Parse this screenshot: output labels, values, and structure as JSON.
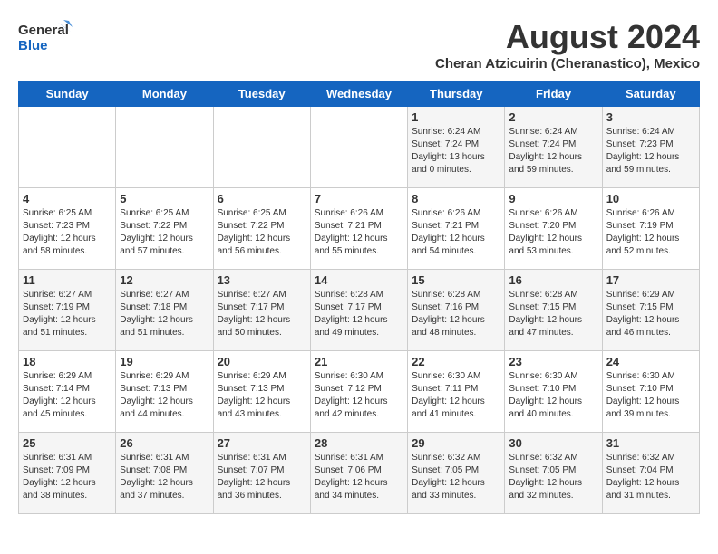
{
  "logo": {
    "line1": "General",
    "line2": "Blue"
  },
  "title": "August 2024",
  "subtitle": "Cheran Atzicuirin (Cheranastico), Mexico",
  "days_of_week": [
    "Sunday",
    "Monday",
    "Tuesday",
    "Wednesday",
    "Thursday",
    "Friday",
    "Saturday"
  ],
  "weeks": [
    [
      {
        "day": "",
        "info": ""
      },
      {
        "day": "",
        "info": ""
      },
      {
        "day": "",
        "info": ""
      },
      {
        "day": "",
        "info": ""
      },
      {
        "day": "1",
        "info": "Sunrise: 6:24 AM\nSunset: 7:24 PM\nDaylight: 13 hours\nand 0 minutes."
      },
      {
        "day": "2",
        "info": "Sunrise: 6:24 AM\nSunset: 7:24 PM\nDaylight: 12 hours\nand 59 minutes."
      },
      {
        "day": "3",
        "info": "Sunrise: 6:24 AM\nSunset: 7:23 PM\nDaylight: 12 hours\nand 59 minutes."
      }
    ],
    [
      {
        "day": "4",
        "info": "Sunrise: 6:25 AM\nSunset: 7:23 PM\nDaylight: 12 hours\nand 58 minutes."
      },
      {
        "day": "5",
        "info": "Sunrise: 6:25 AM\nSunset: 7:22 PM\nDaylight: 12 hours\nand 57 minutes."
      },
      {
        "day": "6",
        "info": "Sunrise: 6:25 AM\nSunset: 7:22 PM\nDaylight: 12 hours\nand 56 minutes."
      },
      {
        "day": "7",
        "info": "Sunrise: 6:26 AM\nSunset: 7:21 PM\nDaylight: 12 hours\nand 55 minutes."
      },
      {
        "day": "8",
        "info": "Sunrise: 6:26 AM\nSunset: 7:21 PM\nDaylight: 12 hours\nand 54 minutes."
      },
      {
        "day": "9",
        "info": "Sunrise: 6:26 AM\nSunset: 7:20 PM\nDaylight: 12 hours\nand 53 minutes."
      },
      {
        "day": "10",
        "info": "Sunrise: 6:26 AM\nSunset: 7:19 PM\nDaylight: 12 hours\nand 52 minutes."
      }
    ],
    [
      {
        "day": "11",
        "info": "Sunrise: 6:27 AM\nSunset: 7:19 PM\nDaylight: 12 hours\nand 51 minutes."
      },
      {
        "day": "12",
        "info": "Sunrise: 6:27 AM\nSunset: 7:18 PM\nDaylight: 12 hours\nand 51 minutes."
      },
      {
        "day": "13",
        "info": "Sunrise: 6:27 AM\nSunset: 7:17 PM\nDaylight: 12 hours\nand 50 minutes."
      },
      {
        "day": "14",
        "info": "Sunrise: 6:28 AM\nSunset: 7:17 PM\nDaylight: 12 hours\nand 49 minutes."
      },
      {
        "day": "15",
        "info": "Sunrise: 6:28 AM\nSunset: 7:16 PM\nDaylight: 12 hours\nand 48 minutes."
      },
      {
        "day": "16",
        "info": "Sunrise: 6:28 AM\nSunset: 7:15 PM\nDaylight: 12 hours\nand 47 minutes."
      },
      {
        "day": "17",
        "info": "Sunrise: 6:29 AM\nSunset: 7:15 PM\nDaylight: 12 hours\nand 46 minutes."
      }
    ],
    [
      {
        "day": "18",
        "info": "Sunrise: 6:29 AM\nSunset: 7:14 PM\nDaylight: 12 hours\nand 45 minutes."
      },
      {
        "day": "19",
        "info": "Sunrise: 6:29 AM\nSunset: 7:13 PM\nDaylight: 12 hours\nand 44 minutes."
      },
      {
        "day": "20",
        "info": "Sunrise: 6:29 AM\nSunset: 7:13 PM\nDaylight: 12 hours\nand 43 minutes."
      },
      {
        "day": "21",
        "info": "Sunrise: 6:30 AM\nSunset: 7:12 PM\nDaylight: 12 hours\nand 42 minutes."
      },
      {
        "day": "22",
        "info": "Sunrise: 6:30 AM\nSunset: 7:11 PM\nDaylight: 12 hours\nand 41 minutes."
      },
      {
        "day": "23",
        "info": "Sunrise: 6:30 AM\nSunset: 7:10 PM\nDaylight: 12 hours\nand 40 minutes."
      },
      {
        "day": "24",
        "info": "Sunrise: 6:30 AM\nSunset: 7:10 PM\nDaylight: 12 hours\nand 39 minutes."
      }
    ],
    [
      {
        "day": "25",
        "info": "Sunrise: 6:31 AM\nSunset: 7:09 PM\nDaylight: 12 hours\nand 38 minutes."
      },
      {
        "day": "26",
        "info": "Sunrise: 6:31 AM\nSunset: 7:08 PM\nDaylight: 12 hours\nand 37 minutes."
      },
      {
        "day": "27",
        "info": "Sunrise: 6:31 AM\nSunset: 7:07 PM\nDaylight: 12 hours\nand 36 minutes."
      },
      {
        "day": "28",
        "info": "Sunrise: 6:31 AM\nSunset: 7:06 PM\nDaylight: 12 hours\nand 34 minutes."
      },
      {
        "day": "29",
        "info": "Sunrise: 6:32 AM\nSunset: 7:05 PM\nDaylight: 12 hours\nand 33 minutes."
      },
      {
        "day": "30",
        "info": "Sunrise: 6:32 AM\nSunset: 7:05 PM\nDaylight: 12 hours\nand 32 minutes."
      },
      {
        "day": "31",
        "info": "Sunrise: 6:32 AM\nSunset: 7:04 PM\nDaylight: 12 hours\nand 31 minutes."
      }
    ]
  ]
}
